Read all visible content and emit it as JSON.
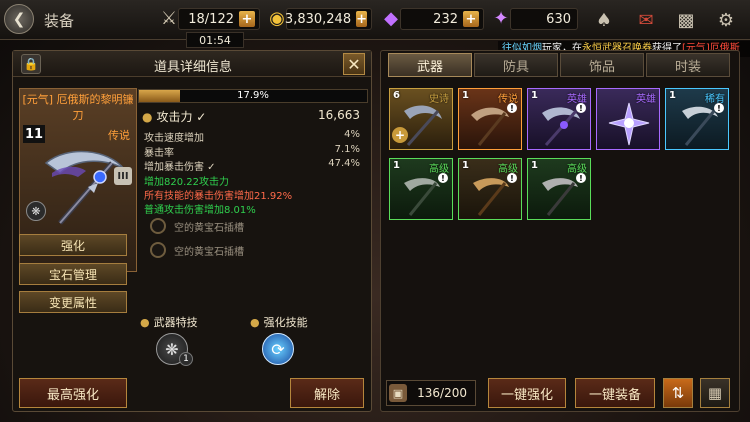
{
  "topbar": {
    "title": "装备",
    "stamina": "18/122",
    "gold": "3,830,248",
    "gems": "232",
    "crystal": "630",
    "timer": "01:54",
    "icons": [
      "crown-bell-icon",
      "mail-icon",
      "chat-icon",
      "gear-icon"
    ]
  },
  "notice": {
    "p1": "往似如烟",
    "p2": "玩家，在",
    "p3": "永恒武器召唤券",
    "p4": "获得了",
    "p5": "[元气]厄俄斯"
  },
  "detail": {
    "title": "道具详细信息",
    "item": {
      "name": "[元气] 厄俄斯的黎明镰刀",
      "level": "11",
      "grade": "传说",
      "tier": "III"
    },
    "progress": {
      "label": "17.9%",
      "value": 0.179
    },
    "attack": {
      "label": "攻击力 ✓",
      "value": "16,663"
    },
    "stats": [
      {
        "label": "攻击速度增加",
        "value": "4%"
      },
      {
        "label": "暴击率",
        "value": "7.1%"
      },
      {
        "label": "增加暴击伤害 ✓",
        "value": "47.4%"
      }
    ],
    "bonuses": [
      {
        "text": "增加820.22攻击力"
      },
      {
        "text": "所有技能的暴击伤害增加21.92%"
      },
      {
        "text": "普通攻击伤害增加8.01%"
      }
    ],
    "sockets": [
      "空的黄宝石插槽",
      "空的黄宝石插槽"
    ],
    "buttons": {
      "enhance": "强化",
      "gem": "宝石管理",
      "change": "变更属性",
      "max": "最高强化",
      "release": "解除"
    },
    "skills": {
      "weapon": "武器特技",
      "enhance": "强化技能",
      "weapon_count": "1"
    }
  },
  "inventory": {
    "tabs": [
      "武器",
      "防具",
      "饰品",
      "时装"
    ],
    "active_tab": 0,
    "slots": [
      {
        "count": "6",
        "grade": "史诗",
        "color": "#c8a040"
      },
      {
        "count": "1",
        "grade": "传说",
        "color": "#ff9f3a"
      },
      {
        "count": "1",
        "grade": "英雄",
        "color": "#a86aff"
      },
      {
        "count": "",
        "grade": "英雄",
        "color": "#a86aff"
      },
      {
        "count": "1",
        "grade": "稀有",
        "color": "#4ac8ff"
      },
      {
        "count": "1",
        "grade": "高级",
        "color": "#5add5a"
      },
      {
        "count": "1",
        "grade": "高级",
        "color": "#5add5a"
      },
      {
        "count": "1",
        "grade": "高级",
        "color": "#5add5a"
      }
    ],
    "capacity": "136/200",
    "buttons": {
      "enhance_all": "一键强化",
      "equip_all": "一键装备"
    }
  },
  "colors": {
    "legend": "#ff9f3a",
    "epic": "#c8a040",
    "hero": "#a86aff",
    "rare": "#4ac8ff",
    "advanced": "#5add5a",
    "bonus": "#2fd04e"
  }
}
